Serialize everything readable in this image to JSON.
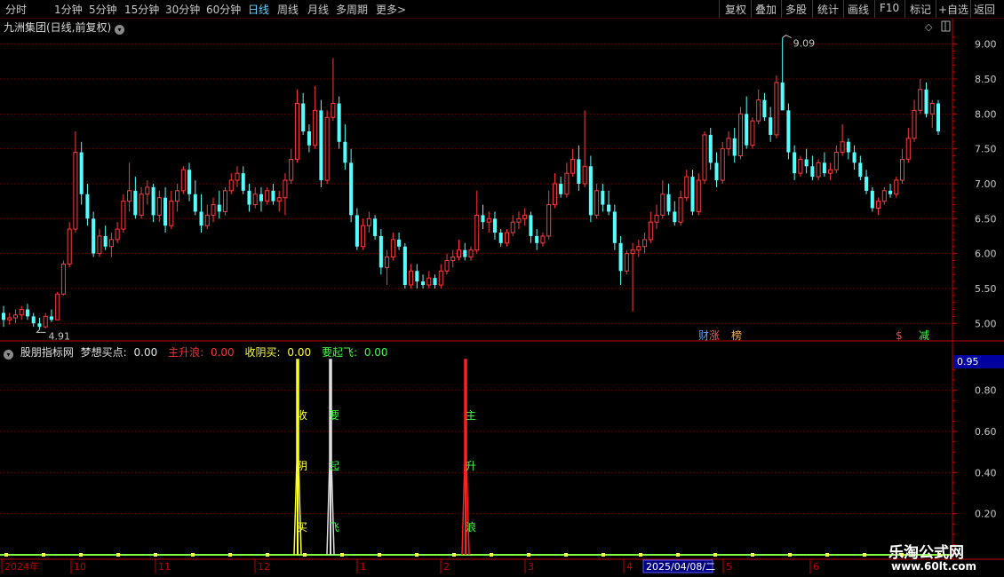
{
  "toolbar": {
    "periods": [
      "分时",
      "1分钟",
      "5分钟",
      "15分钟",
      "30分钟",
      "60分钟",
      "日线",
      "周线",
      "月线",
      "多周期",
      "更多"
    ],
    "more_arrow": ">",
    "active": "日线",
    "right_buttons": [
      "复权",
      "叠加",
      "多股",
      "统计",
      "画线",
      "F10",
      "标记",
      "+自选",
      "返回"
    ]
  },
  "main_chart": {
    "title": "九洲集团(日线,前复权)",
    "high_label": "9.09",
    "low_label": "4.91",
    "y_ticks": [
      "9.00",
      "8.50",
      "8.00",
      "7.50",
      "7.00",
      "6.50",
      "6.00",
      "5.50",
      "5.00"
    ],
    "event_markers": [
      "财",
      "涨",
      "榜",
      "$",
      "减"
    ]
  },
  "indicator": {
    "name": "股朋指标网",
    "items": [
      {
        "label": "梦想买点:",
        "value": "0.00",
        "color": "#e0e0e0"
      },
      {
        "label": "主升浪:",
        "value": "0.00",
        "color": "#ff3030"
      },
      {
        "label": "收阴买:",
        "value": "0.00",
        "color": "#ffff40"
      },
      {
        "label": "要起飞:",
        "value": "0.00",
        "color": "#40ff40"
      }
    ],
    "current_value": "0.95",
    "y_ticks": [
      "0.80",
      "0.60",
      "0.40",
      "0.20"
    ],
    "signal_text": {
      "yellow": [
        "收",
        "阴",
        "买"
      ],
      "white": [
        "要",
        "起",
        "飞"
      ],
      "red": [
        "主",
        "升",
        "浪"
      ]
    }
  },
  "time_axis": {
    "labels": [
      "2024年",
      "10",
      "11",
      "12",
      "1",
      "2",
      "3",
      "4",
      "5",
      "6"
    ],
    "highlight": "2025/04/08/二"
  },
  "watermark": {
    "line1": "乐淘公式网",
    "line2": "www.60lt.com"
  },
  "colors": {
    "up": "#ff3a3a",
    "down": "#54ffff",
    "grid": "#7a0000",
    "axis": "#c00000"
  },
  "chart_data": {
    "type": "candlestick",
    "y_range": [
      4.8,
      9.25
    ],
    "ohlc": [
      [
        5.15,
        5.25,
        4.95,
        5.05
      ],
      [
        5.05,
        5.15,
        4.98,
        5.08
      ],
      [
        5.08,
        5.2,
        5.0,
        5.12
      ],
      [
        5.12,
        5.25,
        5.05,
        5.2
      ],
      [
        5.2,
        5.28,
        5.05,
        5.1
      ],
      [
        5.1,
        5.15,
        4.95,
        5.0
      ],
      [
        5.0,
        5.08,
        4.91,
        4.95
      ],
      [
        4.95,
        5.15,
        4.93,
        5.1
      ],
      [
        5.1,
        5.2,
        5.02,
        5.05
      ],
      [
        5.05,
        5.45,
        5.05,
        5.42
      ],
      [
        5.42,
        5.9,
        5.4,
        5.85
      ],
      [
        5.85,
        6.45,
        5.8,
        6.35
      ],
      [
        6.35,
        7.75,
        6.3,
        7.45
      ],
      [
        7.45,
        7.6,
        6.7,
        6.85
      ],
      [
        6.85,
        7.0,
        6.4,
        6.5
      ],
      [
        6.5,
        6.6,
        5.95,
        6.0
      ],
      [
        6.0,
        6.35,
        5.95,
        6.25
      ],
      [
        6.25,
        6.4,
        6.05,
        6.1
      ],
      [
        6.1,
        6.3,
        5.95,
        6.2
      ],
      [
        6.2,
        6.45,
        6.15,
        6.35
      ],
      [
        6.35,
        6.85,
        6.3,
        6.75
      ],
      [
        6.75,
        7.3,
        6.6,
        6.9
      ],
      [
        6.9,
        7.1,
        6.5,
        6.55
      ],
      [
        6.55,
        6.95,
        6.5,
        6.85
      ],
      [
        6.85,
        7.05,
        6.7,
        6.95
      ],
      [
        6.95,
        7.0,
        6.45,
        6.55
      ],
      [
        6.55,
        6.9,
        6.45,
        6.8
      ],
      [
        6.8,
        6.95,
        6.3,
        6.4
      ],
      [
        6.4,
        6.9,
        6.35,
        6.75
      ],
      [
        6.75,
        7.0,
        6.6,
        6.9
      ],
      [
        6.9,
        7.25,
        6.85,
        7.2
      ],
      [
        7.2,
        7.3,
        6.75,
        6.85
      ],
      [
        6.85,
        7.05,
        6.55,
        6.6
      ],
      [
        6.6,
        6.85,
        6.3,
        6.4
      ],
      [
        6.4,
        6.7,
        6.35,
        6.55
      ],
      [
        6.55,
        6.8,
        6.45,
        6.7
      ],
      [
        6.7,
        6.9,
        6.5,
        6.6
      ],
      [
        6.6,
        6.95,
        6.55,
        6.9
      ],
      [
        6.9,
        7.15,
        6.85,
        7.05
      ],
      [
        7.05,
        7.25,
        6.95,
        7.15
      ],
      [
        7.15,
        7.25,
        6.85,
        6.9
      ],
      [
        6.9,
        7.0,
        6.6,
        6.7
      ],
      [
        6.7,
        6.95,
        6.65,
        6.85
      ],
      [
        6.85,
        6.95,
        6.6,
        6.75
      ],
      [
        6.75,
        6.95,
        6.7,
        6.9
      ],
      [
        6.9,
        7.0,
        6.7,
        6.75
      ],
      [
        6.75,
        6.9,
        6.6,
        6.8
      ],
      [
        6.8,
        7.15,
        6.55,
        7.05
      ],
      [
        7.05,
        7.5,
        7.0,
        7.35
      ],
      [
        7.35,
        8.35,
        7.3,
        8.15
      ],
      [
        8.15,
        8.3,
        7.7,
        7.75
      ],
      [
        7.75,
        7.85,
        7.45,
        7.55
      ],
      [
        7.55,
        8.4,
        7.5,
        8.05
      ],
      [
        8.05,
        8.2,
        6.95,
        7.05
      ],
      [
        7.05,
        8.05,
        7.0,
        7.95
      ],
      [
        7.95,
        8.8,
        7.9,
        8.15
      ],
      [
        8.15,
        8.25,
        7.5,
        7.6
      ],
      [
        7.6,
        7.85,
        7.2,
        7.3
      ],
      [
        7.3,
        7.5,
        6.45,
        6.55
      ],
      [
        6.55,
        6.65,
        6.05,
        6.1
      ],
      [
        6.1,
        6.5,
        6.05,
        6.4
      ],
      [
        6.4,
        6.6,
        6.3,
        6.5
      ],
      [
        6.5,
        6.55,
        6.2,
        6.25
      ],
      [
        6.25,
        6.35,
        5.7,
        5.8
      ],
      [
        5.8,
        6.05,
        5.55,
        5.95
      ],
      [
        5.95,
        6.3,
        5.9,
        6.2
      ],
      [
        6.2,
        6.3,
        6.05,
        6.1
      ],
      [
        6.1,
        6.15,
        5.5,
        5.55
      ],
      [
        5.55,
        5.85,
        5.5,
        5.75
      ],
      [
        5.75,
        5.85,
        5.5,
        5.6
      ],
      [
        5.6,
        5.7,
        5.5,
        5.55
      ],
      [
        5.55,
        5.75,
        5.5,
        5.65
      ],
      [
        5.65,
        5.7,
        5.5,
        5.55
      ],
      [
        5.55,
        5.85,
        5.5,
        5.75
      ],
      [
        5.75,
        6.0,
        5.7,
        5.9
      ],
      [
        5.9,
        6.05,
        5.8,
        5.95
      ],
      [
        5.95,
        6.2,
        5.9,
        6.05
      ],
      [
        6.05,
        6.15,
        5.9,
        5.95
      ],
      [
        5.95,
        6.1,
        5.9,
        6.05
      ],
      [
        6.05,
        6.9,
        6.0,
        6.55
      ],
      [
        6.55,
        6.7,
        6.35,
        6.45
      ],
      [
        6.45,
        6.6,
        6.3,
        6.5
      ],
      [
        6.5,
        6.6,
        6.2,
        6.3
      ],
      [
        6.3,
        6.35,
        6.1,
        6.15
      ],
      [
        6.15,
        6.35,
        6.1,
        6.3
      ],
      [
        6.3,
        6.55,
        6.25,
        6.45
      ],
      [
        6.45,
        6.6,
        6.35,
        6.5
      ],
      [
        6.5,
        6.65,
        6.4,
        6.55
      ],
      [
        6.55,
        6.6,
        6.15,
        6.25
      ],
      [
        6.25,
        6.35,
        6.05,
        6.15
      ],
      [
        6.15,
        6.3,
        6.1,
        6.25
      ],
      [
        6.25,
        6.9,
        6.2,
        6.7
      ],
      [
        6.7,
        7.15,
        6.65,
        7.0
      ],
      [
        7.0,
        7.1,
        6.8,
        6.85
      ],
      [
        6.85,
        7.3,
        6.8,
        7.15
      ],
      [
        7.15,
        7.5,
        7.1,
        7.35
      ],
      [
        7.35,
        7.55,
        6.9,
        7.0
      ],
      [
        7.0,
        8.05,
        6.95,
        7.25
      ],
      [
        7.25,
        7.4,
        6.45,
        6.55
      ],
      [
        6.55,
        7.0,
        6.5,
        6.9
      ],
      [
        6.9,
        7.0,
        6.6,
        6.7
      ],
      [
        6.7,
        6.9,
        6.55,
        6.6
      ],
      [
        6.6,
        6.7,
        6.05,
        6.15
      ],
      [
        6.15,
        6.25,
        5.55,
        5.75
      ],
      [
        5.75,
        6.05,
        5.7,
        6.0
      ],
      [
        6.0,
        6.15,
        5.17,
        6.05
      ],
      [
        6.05,
        6.2,
        5.95,
        6.1
      ],
      [
        6.1,
        6.3,
        6.0,
        6.2
      ],
      [
        6.2,
        6.6,
        6.15,
        6.45
      ],
      [
        6.45,
        6.7,
        6.35,
        6.55
      ],
      [
        6.55,
        7.05,
        6.5,
        6.85
      ],
      [
        6.85,
        7.0,
        6.55,
        6.6
      ],
      [
        6.6,
        6.75,
        6.4,
        6.45
      ],
      [
        6.45,
        6.9,
        6.4,
        6.8
      ],
      [
        6.8,
        7.2,
        6.75,
        7.1
      ],
      [
        7.1,
        7.2,
        6.55,
        6.6
      ],
      [
        6.6,
        7.15,
        6.55,
        7.05
      ],
      [
        7.05,
        7.75,
        7.0,
        7.7
      ],
      [
        7.7,
        7.8,
        7.2,
        7.3
      ],
      [
        7.3,
        7.45,
        6.95,
        7.05
      ],
      [
        7.05,
        7.6,
        7.0,
        7.5
      ],
      [
        7.5,
        7.75,
        7.4,
        7.65
      ],
      [
        7.65,
        7.8,
        7.3,
        7.4
      ],
      [
        7.4,
        8.1,
        7.35,
        8.0
      ],
      [
        8.0,
        8.25,
        7.5,
        7.55
      ],
      [
        7.55,
        7.95,
        7.5,
        7.9
      ],
      [
        7.9,
        8.35,
        7.85,
        8.2
      ],
      [
        8.2,
        8.3,
        7.9,
        7.95
      ],
      [
        7.95,
        8.1,
        7.6,
        7.7
      ],
      [
        7.7,
        8.55,
        7.65,
        8.45
      ],
      [
        8.45,
        9.09,
        8.4,
        8.05
      ],
      [
        8.05,
        8.15,
        7.35,
        7.45
      ],
      [
        7.45,
        7.55,
        7.05,
        7.15
      ],
      [
        7.15,
        7.4,
        7.1,
        7.35
      ],
      [
        7.35,
        7.5,
        7.15,
        7.25
      ],
      [
        7.25,
        7.4,
        7.05,
        7.1
      ],
      [
        7.1,
        7.35,
        7.05,
        7.3
      ],
      [
        7.3,
        7.45,
        7.1,
        7.15
      ],
      [
        7.15,
        7.3,
        7.05,
        7.2
      ],
      [
        7.2,
        7.55,
        7.15,
        7.45
      ],
      [
        7.45,
        7.85,
        7.4,
        7.6
      ],
      [
        7.6,
        7.65,
        7.35,
        7.45
      ],
      [
        7.45,
        7.55,
        7.2,
        7.3
      ],
      [
        7.3,
        7.4,
        7.05,
        7.1
      ],
      [
        7.1,
        7.2,
        6.85,
        6.9
      ],
      [
        6.9,
        6.95,
        6.6,
        6.65
      ],
      [
        6.65,
        6.8,
        6.55,
        6.75
      ],
      [
        6.75,
        6.95,
        6.7,
        6.9
      ],
      [
        6.9,
        7.0,
        6.8,
        6.85
      ],
      [
        6.85,
        7.1,
        6.8,
        7.05
      ],
      [
        7.05,
        7.5,
        7.0,
        7.35
      ],
      [
        7.35,
        7.8,
        7.3,
        7.65
      ],
      [
        7.65,
        8.2,
        7.6,
        8.05
      ],
      [
        8.05,
        8.5,
        8.0,
        8.35
      ],
      [
        8.35,
        8.45,
        7.95,
        8.0
      ],
      [
        8.0,
        8.2,
        7.8,
        8.15
      ],
      [
        8.15,
        8.2,
        7.7,
        7.75
      ]
    ]
  }
}
